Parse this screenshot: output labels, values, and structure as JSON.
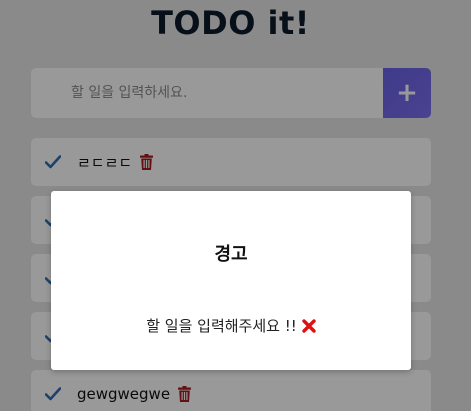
{
  "app": {
    "title": "TODO it!"
  },
  "input": {
    "placeholder": "할 일을 입력하세요.",
    "value": "",
    "add_icon": "plus-icon",
    "add_glyph": "+",
    "accent_color": "#6a62e6"
  },
  "todos": [
    {
      "text": "ㄹㄷㄹㄷ",
      "icon_check": "check-icon",
      "icon_delete": "trash-icon"
    },
    {
      "text": "",
      "icon_check": "check-icon",
      "icon_delete": "trash-icon"
    },
    {
      "text": "",
      "icon_check": "check-icon",
      "icon_delete": "trash-icon"
    },
    {
      "text": "",
      "icon_check": "check-icon",
      "icon_delete": "trash-icon"
    },
    {
      "text": "gewgwegwe",
      "icon_check": "check-icon",
      "icon_delete": "trash-icon"
    }
  ],
  "colors": {
    "check": "#2f6eb5",
    "trash": "#a61c1c",
    "modal_close": "#e01010"
  },
  "modal": {
    "title": "경고",
    "message": "할 일을 입력해주세요 !!",
    "close_icon": "x-icon"
  }
}
